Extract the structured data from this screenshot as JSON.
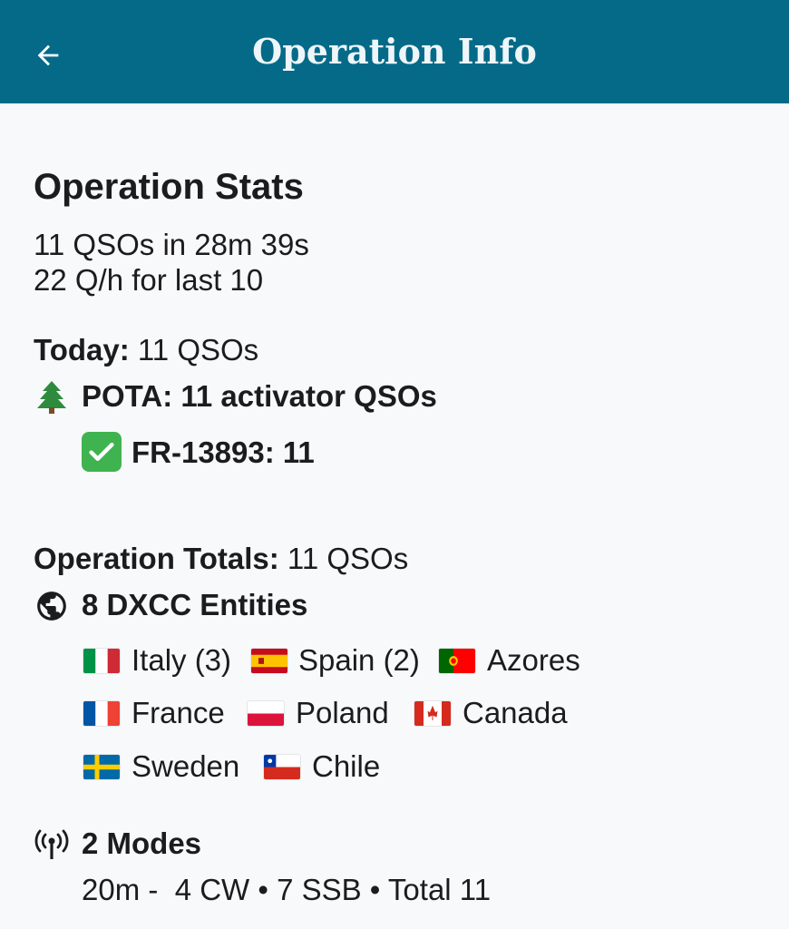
{
  "appbar": {
    "title": "Operation Info",
    "back_icon": "arrow-left-icon",
    "color": "#046a88"
  },
  "stats": {
    "heading": "Operation Stats",
    "qso_line": "11 QSOs in 28m 39s",
    "rate_line": "22 Q/h for last 10"
  },
  "today": {
    "label": "Today:",
    "value": " 11 QSOs",
    "pota_icon": "evergreen-tree-icon",
    "pota_label": "POTA: 11 activator QSOs",
    "park_icon": "check-mark-icon",
    "park_label": "FR-13893: 11"
  },
  "totals": {
    "label": "Operation Totals:",
    "value": " 11 QSOs",
    "dxcc_icon": "globe-icon",
    "dxcc_label": "8 DXCC Entities",
    "entities": [
      {
        "flag": "italy-flag-icon",
        "name": "Italy (3)"
      },
      {
        "flag": "spain-flag-icon",
        "name": "Spain (2)"
      },
      {
        "flag": "portugal-flag-icon",
        "name": "Azores"
      },
      {
        "flag": "france-flag-icon",
        "name": "France"
      },
      {
        "flag": "poland-flag-icon",
        "name": "Poland"
      },
      {
        "flag": "canada-flag-icon",
        "name": "Canada"
      },
      {
        "flag": "sweden-flag-icon",
        "name": "Sweden"
      },
      {
        "flag": "chile-flag-icon",
        "name": "Chile"
      }
    ]
  },
  "modes": {
    "icon": "antenna-icon",
    "label": "2 Modes",
    "detail": "20m -  4 CW • 7 SSB • Total 11"
  }
}
